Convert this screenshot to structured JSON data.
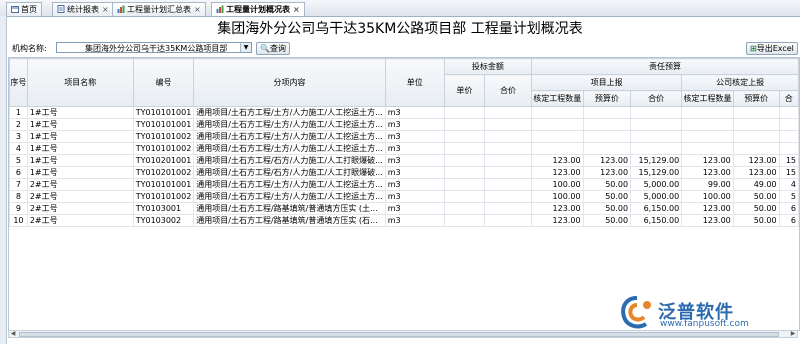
{
  "tabs": [
    {
      "label": "首页",
      "icon": "home-icon"
    },
    {
      "label": "统计报表",
      "icon": "report-icon"
    },
    {
      "label": "工程量计划汇总表",
      "icon": "chart-icon"
    },
    {
      "label": "工程量计划概况表",
      "icon": "chart-icon",
      "active": true
    }
  ],
  "page": {
    "title": "集团海外分公司乌干达35KM公路项目部 工程量计划概况表"
  },
  "toolbar": {
    "org_label": "机构名称:",
    "org_value": "集团海外分公司乌干达35KM公路项目部",
    "query_label": "查询",
    "export_label": "导出Excel"
  },
  "table": {
    "headers": {
      "seq": "序号",
      "project": "项目名称",
      "code": "编号",
      "item": "分项内容",
      "unit": "单位",
      "bid_group": "投标金额",
      "bid_price": "单价",
      "bid_total": "合价",
      "resp_group": "责任预算",
      "proj_report": "项目上报",
      "check_qty": "核定工程数量",
      "budget_price": "预算价",
      "total": "合价",
      "company_check": "公司核定上报",
      "check_qty2": "核定工程数量",
      "budget_price2": "预算价",
      "extra": "合"
    },
    "rows": [
      {
        "seq": "1",
        "project": "1#工号",
        "code": "TY010101001",
        "item": "通用项目/土石方工程/土方/人力施工/人工挖运土方...",
        "unit": "m3",
        "q1": "",
        "p1": "",
        "t1": "",
        "q2": "",
        "p2": "",
        "t2": ""
      },
      {
        "seq": "2",
        "project": "1#工号",
        "code": "TY010101001",
        "item": "通用项目/土石方工程/土方/人力施工/人工挖运土方...",
        "unit": "m3",
        "q1": "",
        "p1": "",
        "t1": "",
        "q2": "",
        "p2": "",
        "t2": ""
      },
      {
        "seq": "3",
        "project": "1#工号",
        "code": "TY010101002",
        "item": "通用项目/土石方工程/土方/人力施工/人工挖运土方...",
        "unit": "m3",
        "q1": "",
        "p1": "",
        "t1": "",
        "q2": "",
        "p2": "",
        "t2": ""
      },
      {
        "seq": "4",
        "project": "1#工号",
        "code": "TY010101002",
        "item": "通用项目/土石方工程/土方/人力施工/人工挖运土方...",
        "unit": "m3",
        "q1": "",
        "p1": "",
        "t1": "",
        "q2": "",
        "p2": "",
        "t2": ""
      },
      {
        "seq": "5",
        "project": "1#工号",
        "code": "TY010201001",
        "item": "通用项目/土石方工程/石方/人力施工/人工打眼爆破...",
        "unit": "m3",
        "q1": "123.00",
        "p1": "123.00",
        "t1": "15,129.00",
        "q2": "123.00",
        "p2": "123.00",
        "t2": "15"
      },
      {
        "seq": "6",
        "project": "1#工号",
        "code": "TY010201002",
        "item": "通用项目/土石方工程/石方/人力施工/人工打眼爆破...",
        "unit": "m3",
        "q1": "123.00",
        "p1": "123.00",
        "t1": "15,129.00",
        "q2": "123.00",
        "p2": "123.00",
        "t2": "15"
      },
      {
        "seq": "7",
        "project": "2#工号",
        "code": "TY010101001",
        "item": "通用项目/土石方工程/土方/人力施工/人工挖运土方...",
        "unit": "m3",
        "q1": "100.00",
        "p1": "50.00",
        "t1": "5,000.00",
        "q2": "99.00",
        "p2": "49.00",
        "t2": "4"
      },
      {
        "seq": "8",
        "project": "2#工号",
        "code": "TY010101002",
        "item": "通用项目/土石方工程/土方/人力施工/人工挖运土方...",
        "unit": "m3",
        "q1": "100.00",
        "p1": "50.00",
        "t1": "5,000.00",
        "q2": "100.00",
        "p2": "50.00",
        "t2": "5"
      },
      {
        "seq": "9",
        "project": "2#工号",
        "code": "TY0103001",
        "item": "通用项目/土石方工程/路基填筑/普通填方压实 (土...",
        "unit": "m3",
        "q1": "123.00",
        "p1": "50.00",
        "t1": "6,150.00",
        "q2": "123.00",
        "p2": "50.00",
        "t2": "6"
      },
      {
        "seq": "10",
        "project": "2#工号",
        "code": "TY0103002",
        "item": "通用项目/土石方工程/路基填筑/普通填方压实 (石...",
        "unit": "m3",
        "q1": "123.00",
        "p1": "50.00",
        "t1": "6,150.00",
        "q2": "123.00",
        "p2": "50.00",
        "t2": "6"
      }
    ]
  },
  "logo": {
    "text": "泛普软件",
    "url": "www.fanpusoft.com"
  },
  "colors": {
    "accent": "#2d6bb0",
    "header_bg": "#e8edf2",
    "border": "#c9d3de"
  }
}
